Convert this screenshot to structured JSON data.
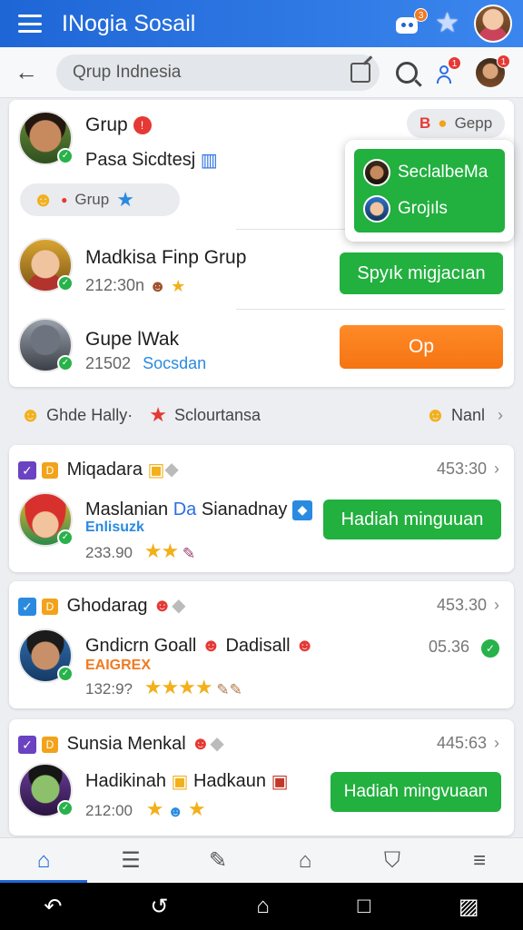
{
  "app": {
    "title": "INogia Sosail"
  },
  "appbar": {
    "bot_badge": "3",
    "star_badge": ""
  },
  "search": {
    "value": "Qrup Indnesia",
    "people_badge": "1",
    "avatar_badge": "1"
  },
  "groups": [
    {
      "name": "Grup",
      "sub": "Pasa Sicdtesj",
      "pill_label": "Grup",
      "top_tag": "B",
      "top_tag2": "Gepp"
    },
    {
      "name": "Madkisa Finp Grup",
      "sub": "212:30n",
      "button": "Spyık migjacıan"
    },
    {
      "name": "Gupe lWak",
      "sub": "21502",
      "sub_link": "Socsdan",
      "button": "Op"
    }
  ],
  "popup": {
    "rows": [
      "SeclalbeMa",
      "Grojıls"
    ]
  },
  "section": {
    "left_label": "Ghde Hally·",
    "mid_label": "Sclourtansa",
    "right_label": "Nanl"
  },
  "feed": [
    {
      "title": "Miqadara",
      "time": "453:30",
      "name": "Maslanian",
      "name_accent": "Da",
      "name_rest": "Sianadnay",
      "tag": "Enlisuzk",
      "count": "233.90",
      "button": "Hadiah minguuan",
      "stars": "★★"
    },
    {
      "title": "Ghodarag",
      "time": "453.30",
      "name": "Gndicrn Goall",
      "name_rest": "Dadisall",
      "tag": "EAIGREX",
      "count": "132:9?",
      "score": "05.36",
      "stars": "★★★★"
    },
    {
      "title": "Sunsia Menkal",
      "time": "445:63",
      "name": "Hadikinah",
      "name_rest": "Hadkaun",
      "count": "212:00",
      "button": "Hadiah mingvuaan",
      "stars": "★"
    }
  ],
  "colors": {
    "primary": "#1e66d6",
    "green": "#22b03f",
    "orange": "#f57412"
  }
}
